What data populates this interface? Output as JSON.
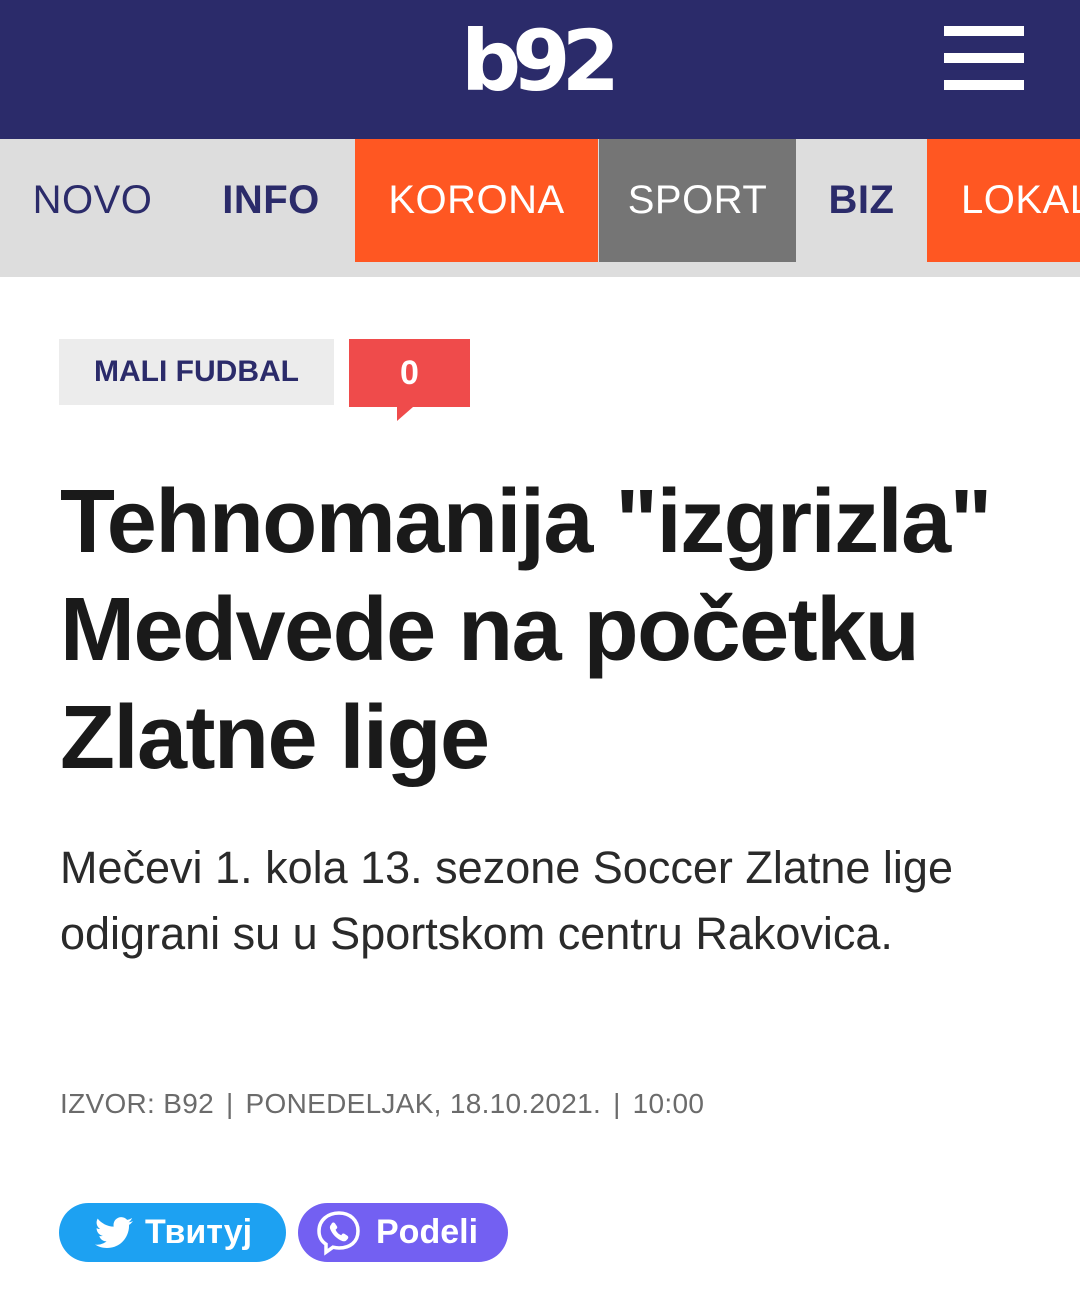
{
  "header": {
    "logo_text": "b92",
    "menu_icon": "hamburger-icon",
    "colors": {
      "header_bg": "#2b2b6a",
      "accent_orange": "#ff5722",
      "sport_gray": "#757575"
    }
  },
  "nav": {
    "items": [
      {
        "label": "NOVO"
      },
      {
        "label": "INFO"
      },
      {
        "label": "KORONA"
      },
      {
        "label": "SPORT"
      },
      {
        "label": "BIZ"
      },
      {
        "label": "LOKAL"
      }
    ]
  },
  "article": {
    "category": "MALI FUDBAL",
    "comment_count": "0",
    "comment_icon": "comment-bubble-icon",
    "title": "Tehnomanija \"izgrizla\" Medvede na početku Zlatne lige",
    "lead": "Mečevi 1. kola 13. sezone Soccer Zlatne lige odigrani su u Sportskom centru Rakovica.",
    "meta": {
      "source": "IZVOR: B92",
      "separator": "|",
      "date": "PONEDELJAK, 18.10.2021.",
      "time": "10:00"
    }
  },
  "share": {
    "tweet_label": "Твитуј",
    "tweet_icon": "twitter-bird-icon",
    "viber_label": "Podeli",
    "viber_icon": "viber-icon",
    "colors": {
      "twitter": "#1da1f2",
      "viber": "#7360f2",
      "comments": "#ef4b4b"
    }
  }
}
